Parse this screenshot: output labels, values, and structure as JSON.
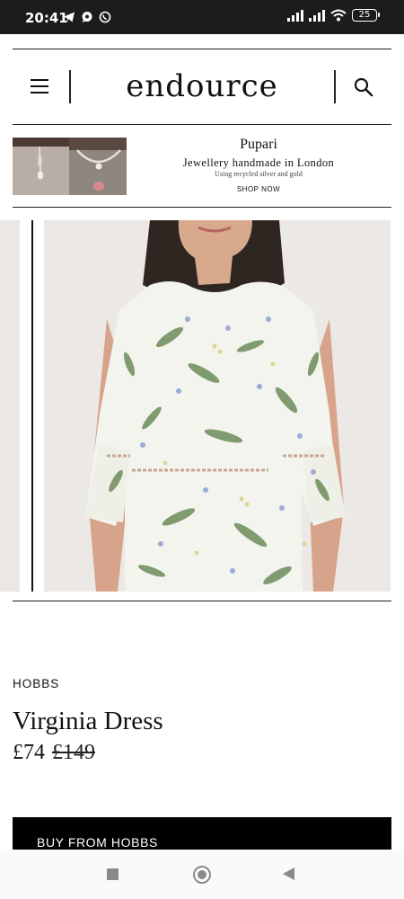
{
  "status_bar": {
    "time": "20:41",
    "left_icons": [
      "telegram-icon",
      "chat-bubble-icon",
      "viber-icon"
    ],
    "right_icons": [
      "signal-icon",
      "signal-icon",
      "wifi-icon"
    ],
    "battery": "25"
  },
  "header": {
    "brand": "endource",
    "menu_icon": "hamburger-icon",
    "search_icon": "search-icon"
  },
  "ad": {
    "title": "Pupari",
    "tagline": "Jewellery handmade in London",
    "subtext": "Using recycled silver and gold",
    "cta": "SHOP NOW"
  },
  "product": {
    "brand": "HOBBS",
    "name": "Virginia Dress",
    "price": "£74",
    "original_price": "£149",
    "buy_label": "BUY FROM HOBBS"
  },
  "nav_bar": {
    "icons": [
      "recent-apps-icon",
      "home-icon",
      "back-icon"
    ]
  }
}
